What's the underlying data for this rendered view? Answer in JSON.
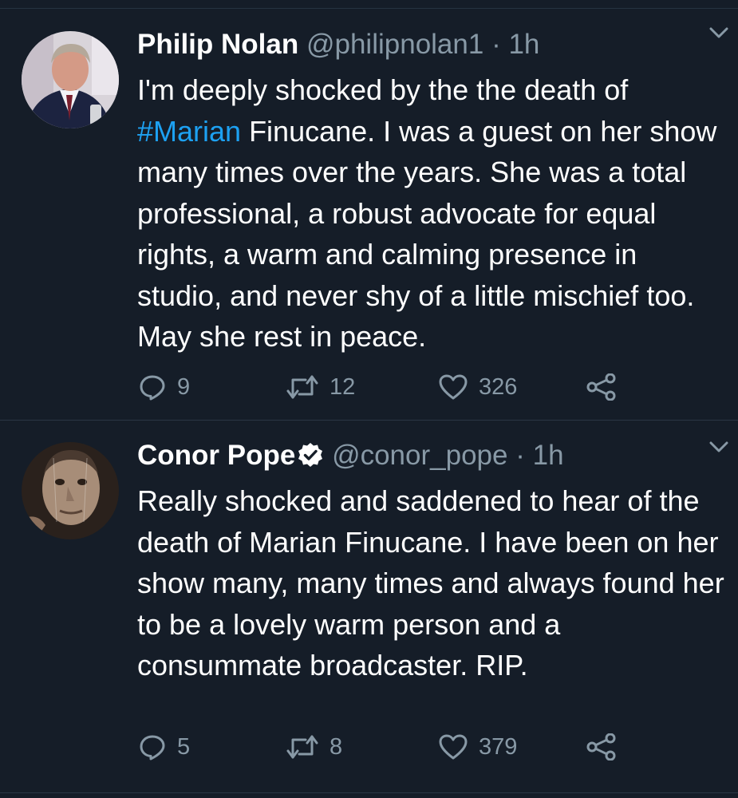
{
  "tweets": [
    {
      "name": "Philip Nolan",
      "handle": "@philipnolan1",
      "separator": "·",
      "time": "1h",
      "verified": false,
      "text_before": "I'm deeply shocked by the the death of ",
      "hashtag": "#Marian",
      "text_after": " Finucane. I was a guest on her show many times over the years. She was a total professional, a robust advocate for equal rights, a warm and calming presence in studio, and never shy of a little mischief too. May she rest in peace.",
      "replies": "9",
      "retweets": "12",
      "likes": "326"
    },
    {
      "name": "Conor Pope",
      "handle": "@conor_pope",
      "separator": "·",
      "time": "1h",
      "verified": true,
      "text": "Really shocked and saddened to hear of the death of Marian Finucane. I have been on her show many, many times and always found her to be a lovely warm person and a consummate broadcaster. RIP.",
      "replies": "5",
      "retweets": "8",
      "likes": "379"
    }
  ],
  "icons": {
    "reply": "reply-icon",
    "retweet": "retweet-icon",
    "like": "heart-icon",
    "share": "share-icon",
    "menu": "chevron-down-icon",
    "verified": "verified-badge-icon"
  },
  "colors": {
    "background": "#151d28",
    "text": "#ffffff",
    "secondary": "#8899a6",
    "link": "#1da1f2",
    "divider": "#2a3644"
  }
}
